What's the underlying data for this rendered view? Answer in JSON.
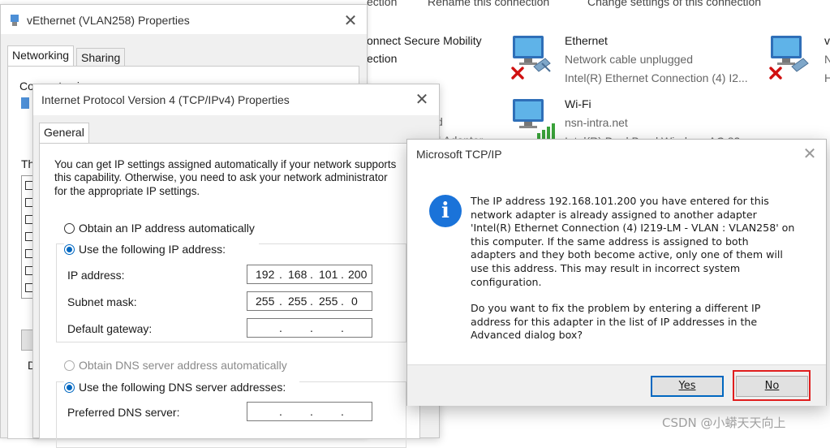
{
  "background_window": {
    "toolbar": [
      "ection",
      "Rename this connection",
      "Change settings of this connection"
    ],
    "partial_left": [
      "onnect Secure Mobility",
      "ection",
      ")",
      "d",
      "l Adapter"
    ],
    "adapters": [
      {
        "name": "Ethernet",
        "status": "Network cable unplugged",
        "device": "Intel(R) Ethernet Connection (4) I2...",
        "disconnected": true
      },
      {
        "name": "Wi-Fi",
        "status": "nsn-intra.net",
        "device": "Intel(R) Dual Band Wireless-AC 82...",
        "disconnected": false
      },
      {
        "name": "v",
        "status": "N",
        "device": "H",
        "disconnected": true
      }
    ]
  },
  "veth_window": {
    "title": "vEthernet (VLAN258) Properties",
    "tabs": [
      "Networking",
      "Sharing"
    ],
    "connect_using_label": "Connect using:",
    "items_label": "Th",
    "d_label": "D"
  },
  "ipv4_window": {
    "title": "Internet Protocol Version 4 (TCP/IPv4) Properties",
    "tab": "General",
    "intro": [
      "You can get IP settings assigned automatically if your network supports",
      "this capability. Otherwise, you need to ask your network administrator",
      "for the appropriate IP settings."
    ],
    "auto_ip_label": "Obtain an IP address automatically",
    "manual_ip_label": "Use the following IP address:",
    "ip_address_label": "IP address:",
    "ip_address": [
      "192",
      "168",
      "101",
      "200"
    ],
    "subnet_label": "Subnet mask:",
    "subnet": [
      "255",
      "255",
      "255",
      "0"
    ],
    "gateway_label": "Default gateway:",
    "gateway": [
      "",
      "",
      "",
      ""
    ],
    "auto_dns_label": "Obtain DNS server address automatically",
    "manual_dns_label": "Use the following DNS server addresses:",
    "preferred_dns_label": "Preferred DNS server:",
    "preferred_dns": [
      "",
      "",
      "",
      ""
    ],
    "selected_ip_mode": "manual",
    "selected_dns_mode": "manual"
  },
  "message_box": {
    "title": "Microsoft TCP/IP",
    "icon": "info-icon",
    "icon_glyph": "i",
    "paragraph1": [
      "The IP address 192.168.101.200 you have entered for this",
      "network adapter is already assigned to another adapter",
      "'Intel(R) Ethernet Connection (4) I219-LM - VLAN : VLAN258' on",
      "this computer. If the same address is assigned to both",
      "adapters and they both become active, only one of them will",
      "use this address.  This may result in incorrect system",
      "configuration."
    ],
    "paragraph2": [
      "Do you want to fix the problem by entering a different IP",
      "address for this adapter in the list of IP addresses in the",
      "Advanced dialog box?"
    ],
    "yes_label": "Yes",
    "no_label": "No",
    "highlight_color": "#e01e1e"
  },
  "close_glyph": "✕",
  "watermark": "CSDN @小蟒天天向上"
}
